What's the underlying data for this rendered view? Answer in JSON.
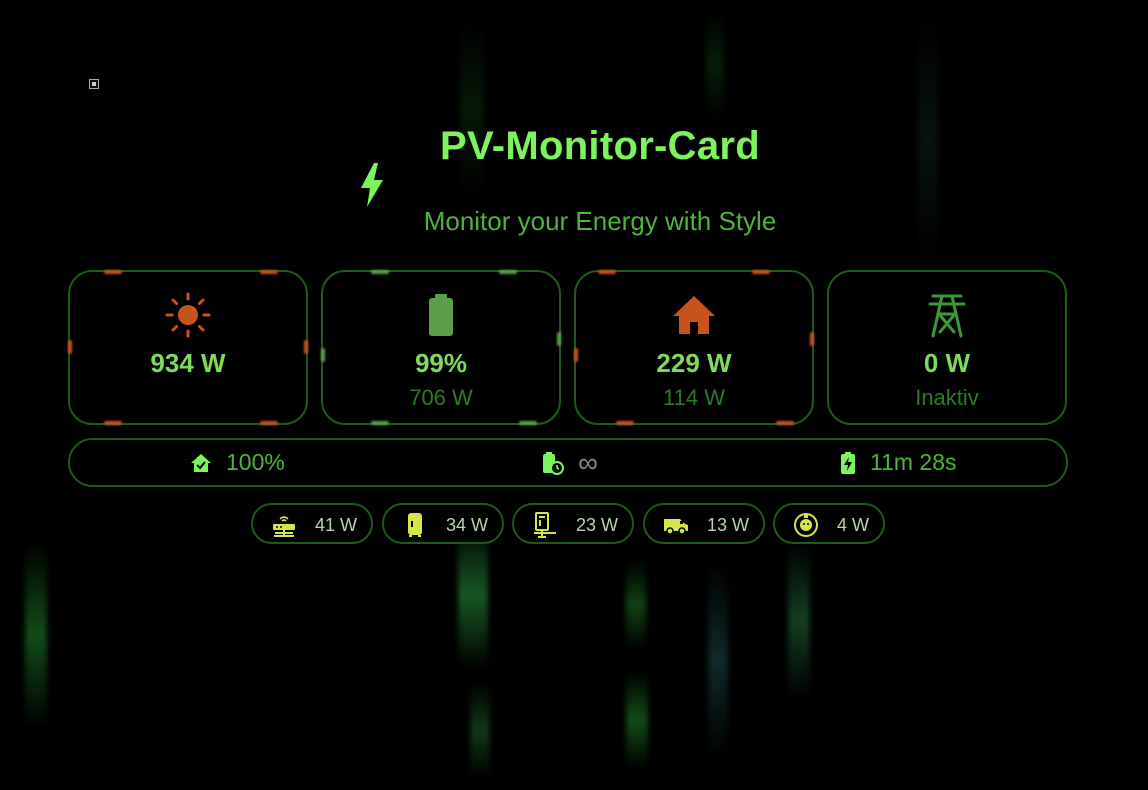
{
  "header": {
    "title": "PV-Monitor-Card",
    "subtitle": "Monitor your Energy with Style"
  },
  "tiles": [
    {
      "name": "solar",
      "icon": "sun-icon",
      "primary": "934 W",
      "secondary": "",
      "accent": "#c8541c"
    },
    {
      "name": "battery",
      "icon": "battery-icon",
      "primary": "99%",
      "secondary": "706 W",
      "accent": "#5aa04a"
    },
    {
      "name": "house",
      "icon": "house-icon",
      "primary": "229 W",
      "secondary": "114 W",
      "accent": "#c8541c"
    },
    {
      "name": "grid",
      "icon": "power-tower-icon",
      "primary": "0 W",
      "secondary": "Inaktiv",
      "accent": "#3a9a3a"
    }
  ],
  "status": {
    "autarky": "100%",
    "battery_time": "∞",
    "charge_time": "11m 28s"
  },
  "consumers": [
    {
      "icon": "router-icon",
      "value": "41 W"
    },
    {
      "icon": "fridge-icon",
      "value": "34 W"
    },
    {
      "icon": "desk-pc-icon",
      "value": "23 W"
    },
    {
      "icon": "van-icon",
      "value": "13 W"
    },
    {
      "icon": "robot-vacuum-icon",
      "value": "4 W"
    }
  ],
  "colors": {
    "title_green": "#7cf45c",
    "text_green": "#4fb43a",
    "border_green": "#1f5a1a",
    "solar_orange": "#c8541c",
    "house_red": "#c8541c",
    "icon_yellow": "#d6e64a"
  }
}
